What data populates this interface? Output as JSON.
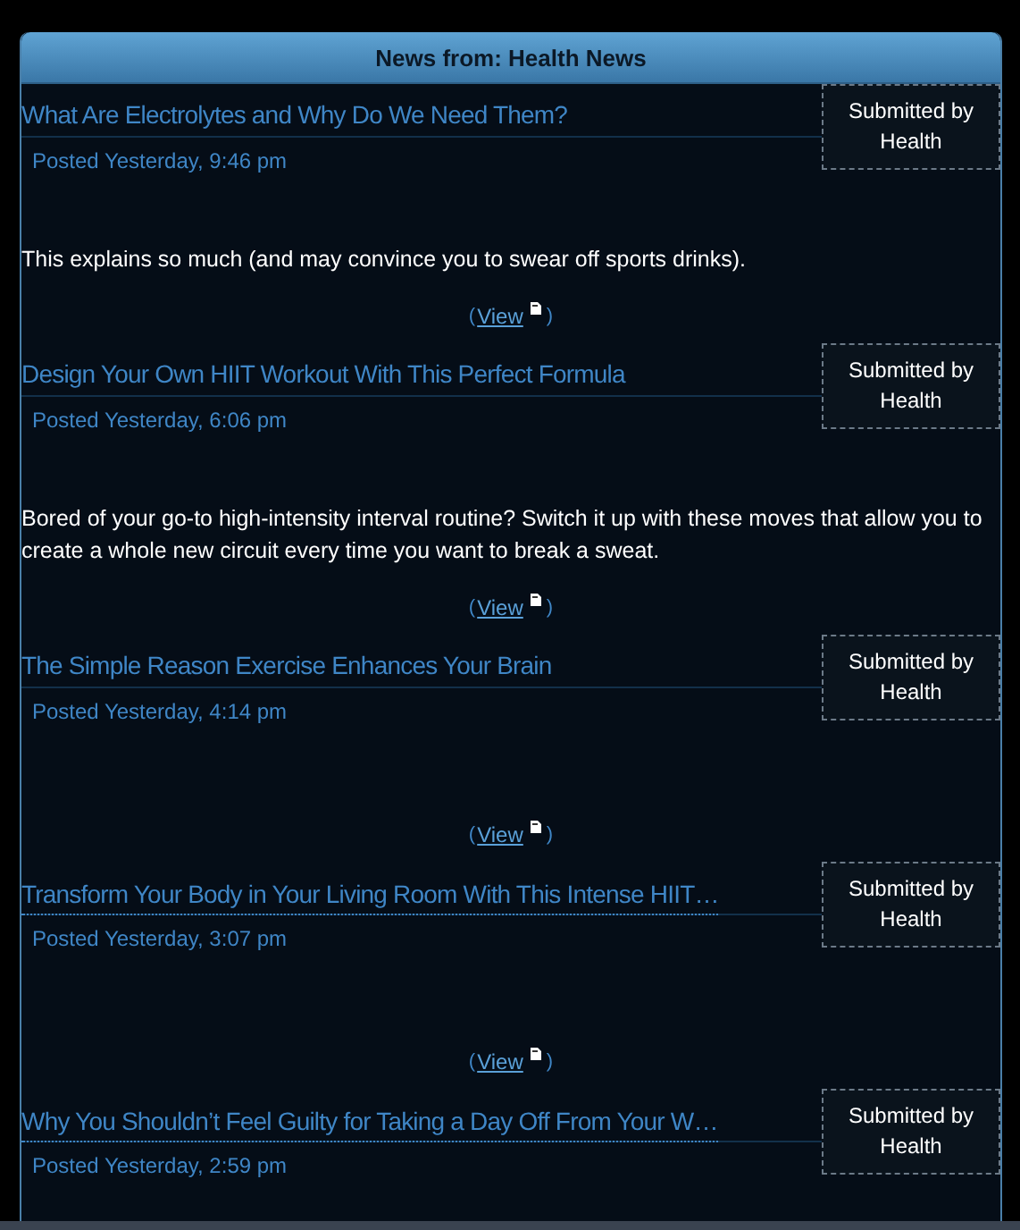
{
  "panel": {
    "title": "News from: Health News"
  },
  "items": [
    {
      "title": "What Are Electrolytes and Why Do We Need Them?",
      "abbreviated": false,
      "posted": "Posted Yesterday, 9:46 pm",
      "submitted": [
        "Submitted by",
        "Health"
      ],
      "description": "This explains so much (and may convince you to swear off sports drinks).",
      "view": {
        "open": "(",
        "link": "View",
        "close": ")"
      }
    },
    {
      "title": "Design Your Own HIIT Workout With This Perfect Formula",
      "abbreviated": false,
      "posted": "Posted Yesterday, 6:06 pm",
      "submitted": [
        "Submitted by",
        "Health"
      ],
      "description": "Bored of your go-to high-intensity interval routine? Switch it up with these moves that allow you to create a whole new circuit every time you want to break a sweat.",
      "view": {
        "open": "(",
        "link": "View",
        "close": ")"
      }
    },
    {
      "title": "The Simple Reason Exercise Enhances Your Brain",
      "abbreviated": false,
      "posted": "Posted Yesterday, 4:14 pm",
      "submitted": [
        "Submitted by",
        "Health"
      ],
      "view": {
        "open": "(",
        "link": "View",
        "close": ")"
      }
    },
    {
      "title": "Transform Your Body in Your Living Room With This Intense HIIT…",
      "abbreviated": true,
      "posted": "Posted Yesterday, 3:07 pm",
      "submitted": [
        "Submitted by",
        "Health"
      ],
      "view": {
        "open": "(",
        "link": "View",
        "close": ")"
      }
    },
    {
      "title": "Why You Shouldn’t Feel Guilty for Taking a Day Off From Your W…",
      "abbreviated": true,
      "posted": "Posted Yesterday, 2:59 pm",
      "submitted": [
        "Submitted by",
        "Health"
      ]
    }
  ]
}
